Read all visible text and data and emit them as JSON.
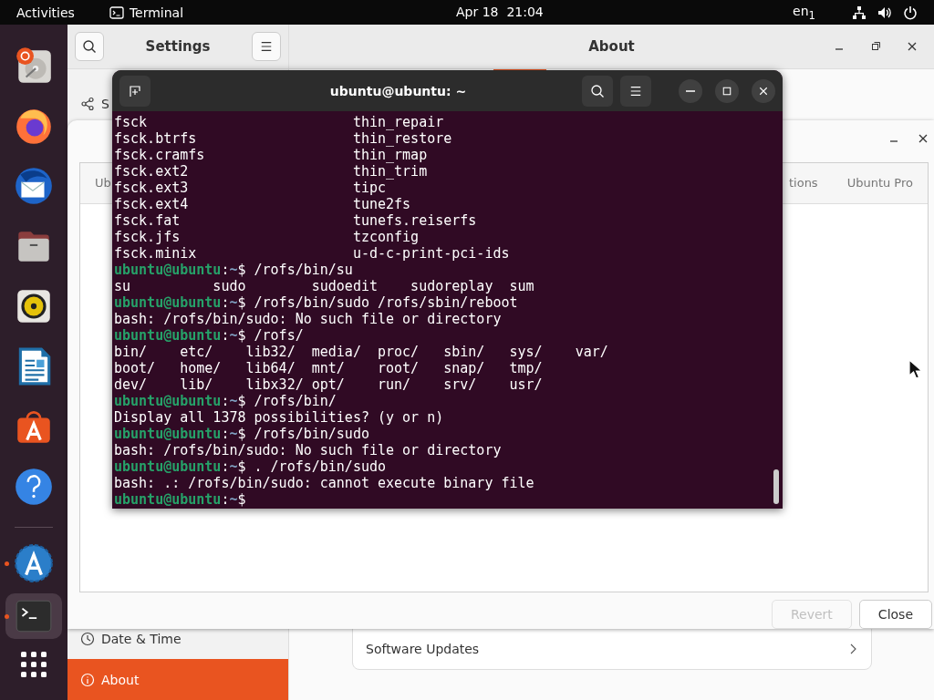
{
  "top_bar": {
    "activities": "Activities",
    "app_menu": "Terminal",
    "clock": "Apr 18  21:04",
    "keyboard": "en$_{1}$"
  },
  "dock": {
    "pinned": [
      {
        "kind": "disk",
        "selected": false
      },
      {
        "kind": "browser",
        "selected": false
      },
      {
        "kind": "mail",
        "selected": false
      },
      {
        "kind": "files",
        "selected": false
      },
      {
        "kind": "music",
        "selected": false
      },
      {
        "kind": "writer",
        "selected": false
      },
      {
        "kind": "store",
        "selected": false
      },
      {
        "kind": "help",
        "selected": false
      }
    ],
    "others": [
      {
        "kind": "updater",
        "running": true,
        "selected": false
      },
      {
        "kind": "terminal",
        "running": true,
        "selected": true
      }
    ]
  },
  "settings": {
    "sidebar_title": "Settings",
    "page_title": "About",
    "sidebar": [
      {
        "kind": "share",
        "label": "S",
        "selected": false
      },
      {
        "kind": "clock",
        "label": "Date & Time",
        "selected": false
      },
      {
        "kind": "info",
        "label": "About",
        "selected": true
      }
    ],
    "rows": [
      {
        "label": "Software Updates"
      }
    ]
  },
  "dialog": {
    "tabs": [
      {
        "label": "Ub",
        "selected": false
      },
      {
        "label": "tions",
        "selected": false
      },
      {
        "label": "Ubuntu Pro",
        "selected": false
      }
    ],
    "buttons": [
      {
        "label": "Revert",
        "disabled": true
      },
      {
        "label": "Close",
        "disabled": false
      }
    ]
  },
  "terminal": {
    "title": "ubuntu@ubuntu: ~",
    "separator": ":",
    "lines": [
      {
        "kind": "output",
        "text": "fsck                         thin_repair"
      },
      {
        "kind": "output",
        "text": "fsck.btrfs                   thin_restore"
      },
      {
        "kind": "output",
        "text": "fsck.cramfs                  thin_rmap"
      },
      {
        "kind": "output",
        "text": "fsck.ext2                    thin_trim"
      },
      {
        "kind": "output",
        "text": "fsck.ext3                    tipc"
      },
      {
        "kind": "output",
        "text": "fsck.ext4                    tune2fs"
      },
      {
        "kind": "output",
        "text": "fsck.fat                     tunefs.reiserfs"
      },
      {
        "kind": "output",
        "text": "fsck.jfs                     tzconfig"
      },
      {
        "kind": "output",
        "text": "fsck.minix                   u-d-c-print-pci-ids"
      },
      {
        "kind": "prompt",
        "user": "ubuntu@ubuntu",
        "path": "~",
        "command": "$ /rofs/bin/su"
      },
      {
        "kind": "output",
        "text": "su          sudo        sudoedit    sudoreplay  sum"
      },
      {
        "kind": "prompt",
        "user": "ubuntu@ubuntu",
        "path": "~",
        "command": "$ /rofs/bin/sudo /rofs/sbin/reboot"
      },
      {
        "kind": "output",
        "text": "bash: /rofs/bin/sudo: No such file or directory"
      },
      {
        "kind": "prompt",
        "user": "ubuntu@ubuntu",
        "path": "~",
        "command": "$ /rofs/"
      },
      {
        "kind": "output",
        "text": "bin/    etc/    lib32/  media/  proc/   sbin/   sys/    var/"
      },
      {
        "kind": "output",
        "text": "boot/   home/   lib64/  mnt/    root/   snap/   tmp/"
      },
      {
        "kind": "output",
        "text": "dev/    lib/    libx32/ opt/    run/    srv/    usr/"
      },
      {
        "kind": "prompt",
        "user": "ubuntu@ubuntu",
        "path": "~",
        "command": "$ /rofs/bin/"
      },
      {
        "kind": "output",
        "text": "Display all 1378 possibilities? (y or n)"
      },
      {
        "kind": "prompt",
        "user": "ubuntu@ubuntu",
        "path": "~",
        "command": "$ /rofs/bin/sudo"
      },
      {
        "kind": "output",
        "text": "bash: /rofs/bin/sudo: No such file or directory"
      },
      {
        "kind": "prompt",
        "user": "ubuntu@ubuntu",
        "path": "~",
        "command": "$ . /rofs/bin/sudo"
      },
      {
        "kind": "output",
        "text": "bash: .: /rofs/bin/sudo: cannot execute binary file"
      },
      {
        "kind": "prompt",
        "user": "ubuntu@ubuntu",
        "path": "~",
        "command": "$"
      }
    ]
  }
}
